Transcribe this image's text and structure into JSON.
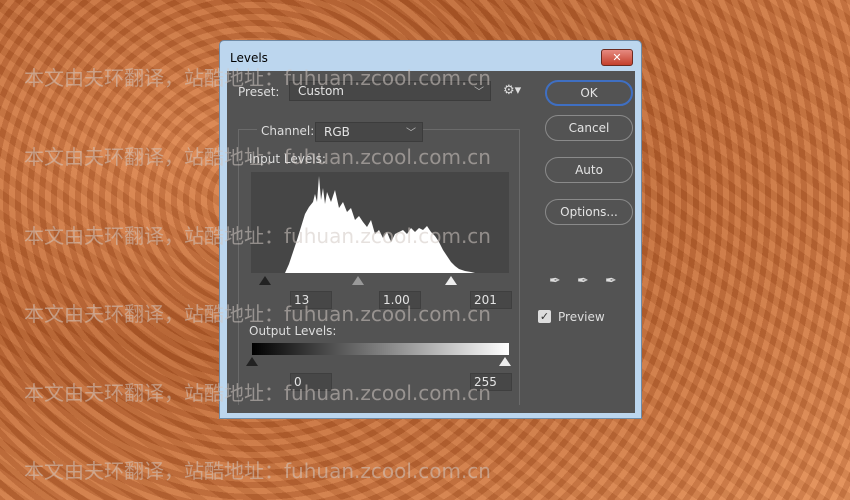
{
  "dialog": {
    "title": "Levels",
    "close": "✕"
  },
  "preset": {
    "label": "Preset:",
    "value": "Custom"
  },
  "channel": {
    "label": "Channel:",
    "value": "RGB"
  },
  "input": {
    "label": "Input Levels:",
    "black": "13",
    "gamma": "1.00",
    "white": "201"
  },
  "output": {
    "label": "Output Levels:",
    "black": "0",
    "white": "255"
  },
  "buttons": {
    "ok": "OK",
    "cancel": "Cancel",
    "auto": "Auto",
    "options": "Options..."
  },
  "preview": {
    "label": "Preview",
    "checked": true
  },
  "icons": [
    "gear-icon",
    "black-eyedropper-icon",
    "gray-eyedropper-icon",
    "white-eyedropper-icon"
  ],
  "watermark": "本文由夫环翻译，站酷地址：fuhuan.zcool.com.cn"
}
